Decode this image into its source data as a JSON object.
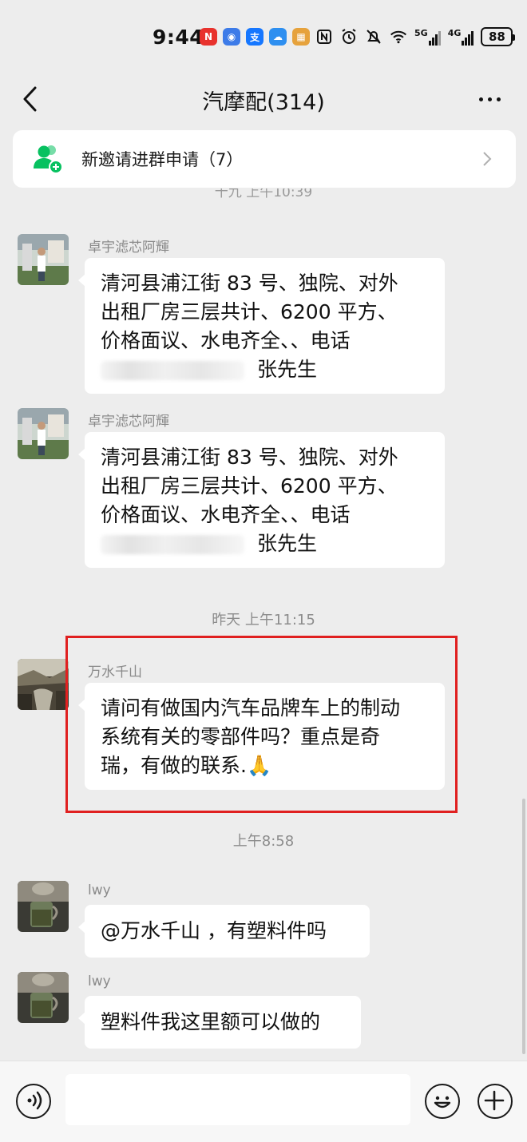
{
  "status_bar": {
    "time": "9:44",
    "signal_labels": [
      "5G",
      "4G"
    ],
    "battery": "88",
    "app_icons": [
      "news-app-icon",
      "vpn-app-icon",
      "alipay-icon",
      "cloud-app-icon",
      "calendar-app-icon"
    ]
  },
  "header": {
    "title": "汽摩配(314)"
  },
  "invite_banner": {
    "label": "新邀请进群申请（7）"
  },
  "faded_timestamp": "十九 上午10:39",
  "messages": [
    {
      "sender": "卓宇滤芯阿輝",
      "lines": [
        "清河县浦江街 83 号、独院、对外",
        "出租厂房三层共计、6200 平方、",
        "价格面议、水电齐全、、电话"
      ],
      "last_line": "张先生"
    },
    {
      "sender": "卓宇滤芯阿輝",
      "lines": [
        "清河县浦江街 83 号、独院、对外",
        "出租厂房三层共计、6200 平方、",
        "价格面议、水电齐全、、电话"
      ],
      "last_line": "张先生"
    },
    {
      "sender": "万水千山",
      "lines": [
        "请问有做国内汽车品牌车上的制动",
        "系统有关的零部件吗？重点是奇",
        "瑞，有做的联系."
      ],
      "emoji": "🙏"
    },
    {
      "sender": "lwy",
      "lines": [
        "@万水千山 ，有塑料件吗"
      ]
    },
    {
      "sender": "lwy",
      "lines": [
        "塑料件我这里额可以做的"
      ]
    }
  ],
  "timestamps": [
    "昨天 上午11:15",
    "上午8:58"
  ],
  "input_bar": {
    "placeholder": ""
  },
  "colors": {
    "background": "#ededed",
    "bubble": "#ffffff",
    "highlight": "#e02020",
    "invite_icon": "#07c160"
  }
}
